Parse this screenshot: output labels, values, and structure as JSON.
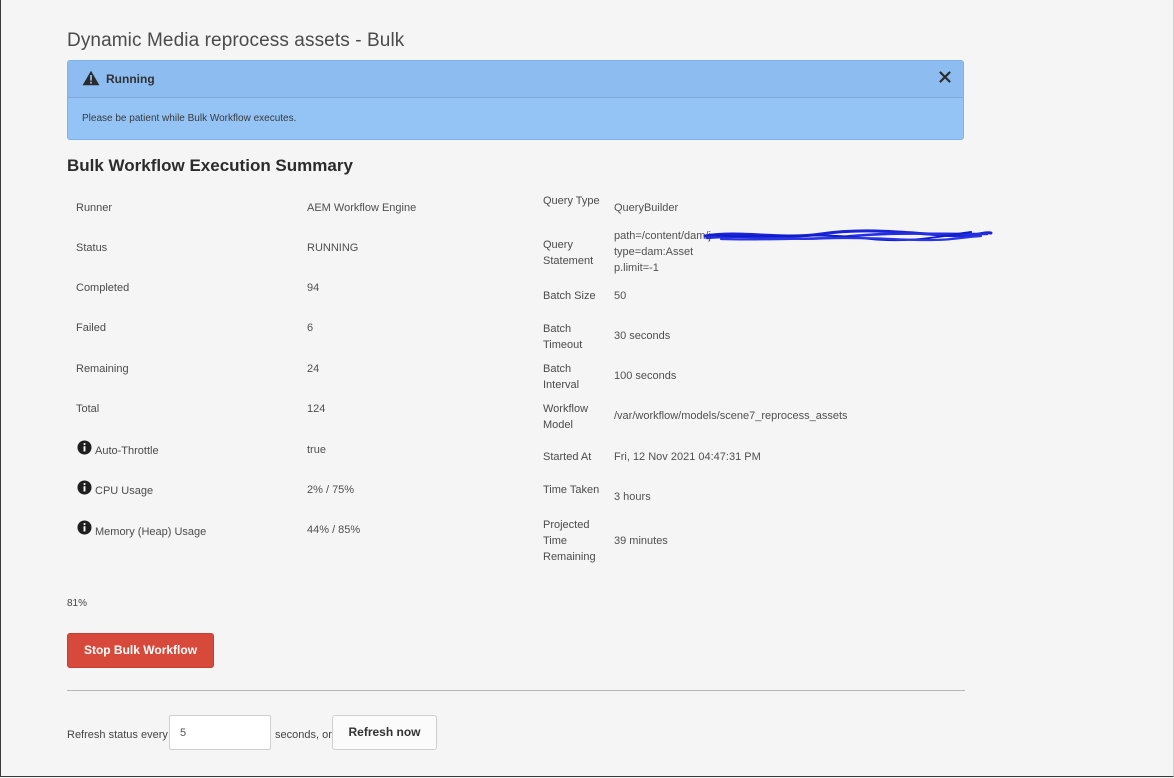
{
  "page": {
    "title": "Dynamic Media reprocess assets - Bulk"
  },
  "alert": {
    "icon": "warning-icon",
    "title": "Running",
    "message": "Please be patient while Bulk Workflow executes.",
    "close_icon": "close-icon",
    "background_color": "#94c4f5"
  },
  "summary": {
    "title": "Bulk Workflow Execution Summary",
    "left_rows": [
      {
        "label": "Runner",
        "value": "AEM Workflow Engine",
        "info": false
      },
      {
        "label": "Status",
        "value": "RUNNING",
        "info": false
      },
      {
        "label": "Completed",
        "value": "94",
        "info": false
      },
      {
        "label": "Failed",
        "value": "6",
        "info": false
      },
      {
        "label": "Remaining",
        "value": "24",
        "info": false
      },
      {
        "label": "Total",
        "value": "124",
        "info": false
      },
      {
        "label": "Auto-Throttle",
        "value": "true",
        "info": true
      },
      {
        "label": "CPU Usage",
        "value": "2% / 75%",
        "info": true
      },
      {
        "label": "Memory (Heap) Usage",
        "value": "44% / 85%",
        "info": true
      }
    ],
    "right_rows": [
      {
        "label": "Query Type",
        "value": "QueryBuilder"
      },
      {
        "label": "Query Statement",
        "value_lines": [
          "path=/content/dam/j",
          "type=dam:Asset",
          "p.limit=-1"
        ]
      },
      {
        "label": "Batch Size",
        "value": "50"
      },
      {
        "label": "Batch Timeout",
        "value": "30 seconds"
      },
      {
        "label": "Batch Interval",
        "value": "100 seconds"
      },
      {
        "label": "Workflow Model",
        "value": "/var/workflow/models/scene7_reprocess_assets"
      },
      {
        "label": "Started At",
        "value": "Fri, 12 Nov 2021 04:47:31 PM"
      },
      {
        "label": "Time Taken",
        "value": "3 hours"
      },
      {
        "label": "Projected Time Remaining",
        "value": "39 minutes"
      }
    ]
  },
  "progress": {
    "percent_label": "81%"
  },
  "actions": {
    "stop_label": "Stop Bulk Workflow",
    "stop_color": "#d7493a"
  },
  "refresh": {
    "label_before": "Refresh status every",
    "interval_value": "5",
    "label_after": "seconds, or",
    "button_label": "Refresh now"
  }
}
